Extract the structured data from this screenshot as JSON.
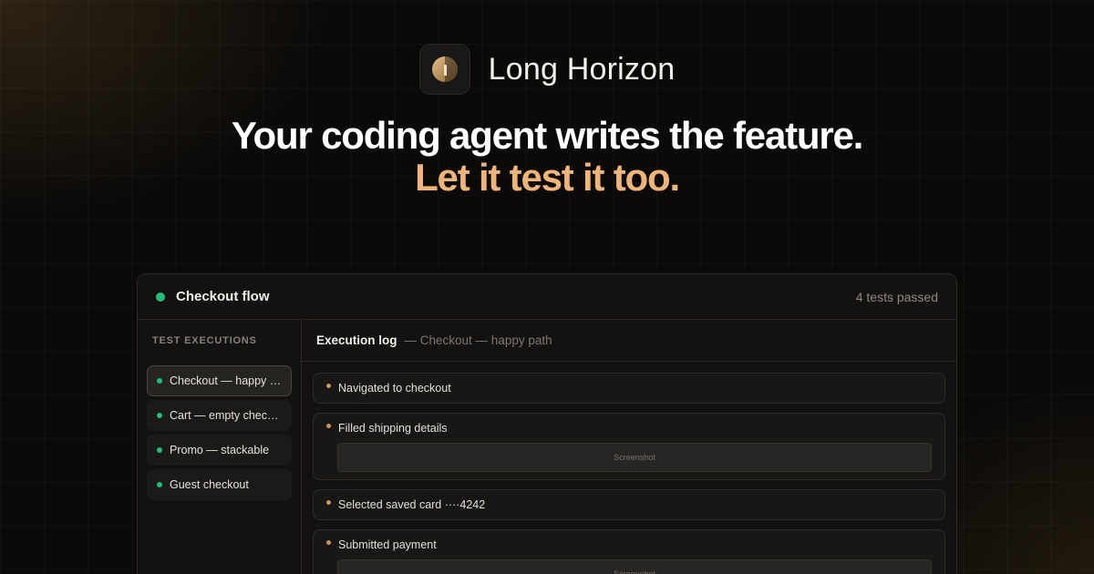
{
  "brand": {
    "name": "Long Horizon",
    "logo_icon": "horizon-logo-icon",
    "accent": "#efb477"
  },
  "headline": {
    "line1": "Your coding agent writes the feature.",
    "line2": "Let it test it too."
  },
  "panel": {
    "title": "Checkout flow",
    "status": "4 tests passed",
    "status_color": "#1fbf7a",
    "sidebar_label": "TEST EXECUTIONS",
    "executions": [
      {
        "label": "Checkout — happy path",
        "active": true
      },
      {
        "label": "Cart — empty checkout",
        "active": false
      },
      {
        "label": "Promo — stackable",
        "active": false
      },
      {
        "label": "Guest checkout",
        "active": false
      }
    ],
    "log": {
      "title": "Execution log",
      "subtitle": "— Checkout — happy path",
      "steps": [
        {
          "text": "Navigated to checkout",
          "screenshot": ""
        },
        {
          "text": "Filled shipping details",
          "screenshot": "Screenshot"
        },
        {
          "text": "Selected saved card ····4242",
          "screenshot": ""
        },
        {
          "text": "Submitted payment",
          "screenshot": "Screenshot"
        }
      ]
    }
  }
}
